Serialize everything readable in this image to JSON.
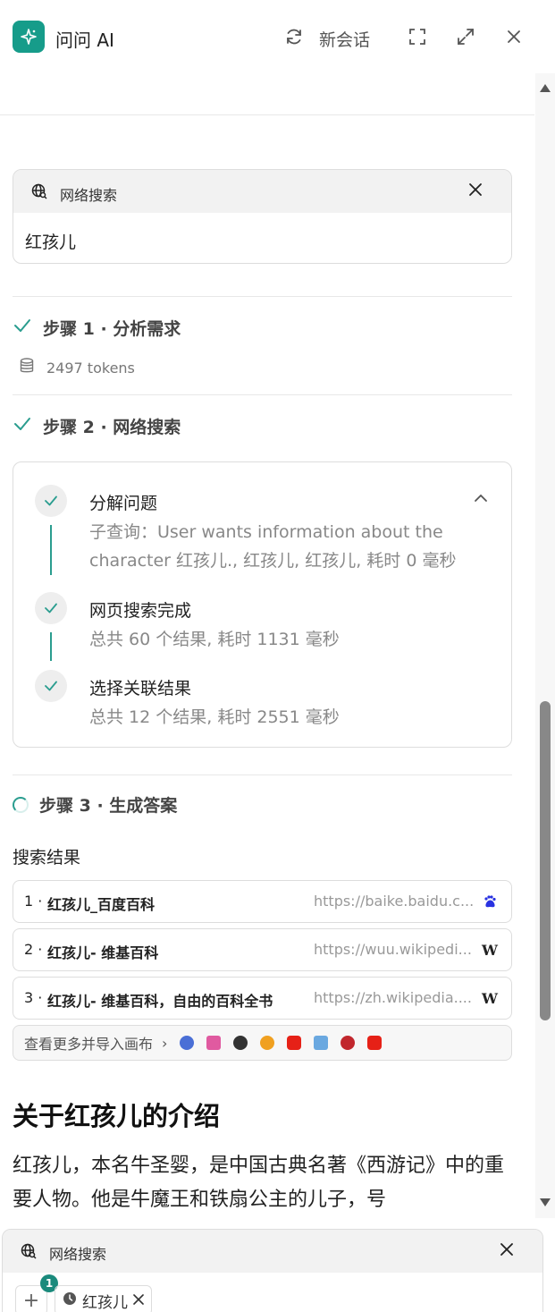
{
  "header": {
    "title": "问问 AI",
    "new_chat_label": "新会话"
  },
  "query_card": {
    "label": "网络搜索",
    "query": "红孩儿"
  },
  "steps": {
    "step1": {
      "title": "步骤 1 · 分析需求",
      "tokens": "2497 tokens"
    },
    "step2": {
      "title": "步骤 2 · 网络搜索"
    },
    "step3": {
      "title": "步骤 3 · 生成答案"
    }
  },
  "substeps": [
    {
      "title": "分解问题",
      "detail": "子查询：User wants information about the character 红孩儿., 红孩儿, 红孩儿, 耗时 0 毫秒"
    },
    {
      "title": "网页搜索完成",
      "detail": "总共 60 个结果, 耗时 1131 毫秒"
    },
    {
      "title": "选择关联结果",
      "detail": "总共 12 个结果, 耗时 2551 毫秒"
    }
  ],
  "results": {
    "label": "搜索结果",
    "items": [
      {
        "num": "1 ·",
        "title": "红孩儿_百度百科",
        "url": "https://baike.baidu.c...",
        "icon": "baidu-paw-icon"
      },
      {
        "num": "2 ·",
        "title": "红孩儿- 维基百科",
        "url": "https://wuu.wikipedi...",
        "icon": "wikipedia-icon"
      },
      {
        "num": "3 ·",
        "title": "红孩儿- 维基百科，自由的百科全书",
        "url": "https://zh.wikipedia....",
        "icon": "wikipedia-icon"
      }
    ],
    "more_label": "查看更多并导入画布",
    "more_arrow": "›",
    "source_icons": [
      {
        "name": "globe-source-icon",
        "color": "#4a6fd6"
      },
      {
        "name": "colorful-source-icon",
        "color": "#e05aa0"
      },
      {
        "name": "apple-source-icon",
        "color": "#333333"
      },
      {
        "name": "amazon-source-icon",
        "color": "#f0a020"
      },
      {
        "name": "youtube-source-icon",
        "color": "#e62117"
      },
      {
        "name": "news-source-icon",
        "color": "#6aa8e0"
      },
      {
        "name": "quora-source-icon",
        "color": "#c1272d"
      },
      {
        "name": "youtube-source-icon-2",
        "color": "#e62117"
      }
    ]
  },
  "answer": {
    "title": "关于红孩儿的介绍",
    "text": "红孩儿，本名牛圣婴，是中国古典名著《西游记》中的重要人物。他是牛魔王和铁扇公主的儿子，号"
  },
  "composer": {
    "label": "网络搜索",
    "badge": "1",
    "add": "+",
    "chip_text": "红孩儿"
  },
  "colors": {
    "accent": "#169c8a",
    "check": "#2a9d8f"
  }
}
